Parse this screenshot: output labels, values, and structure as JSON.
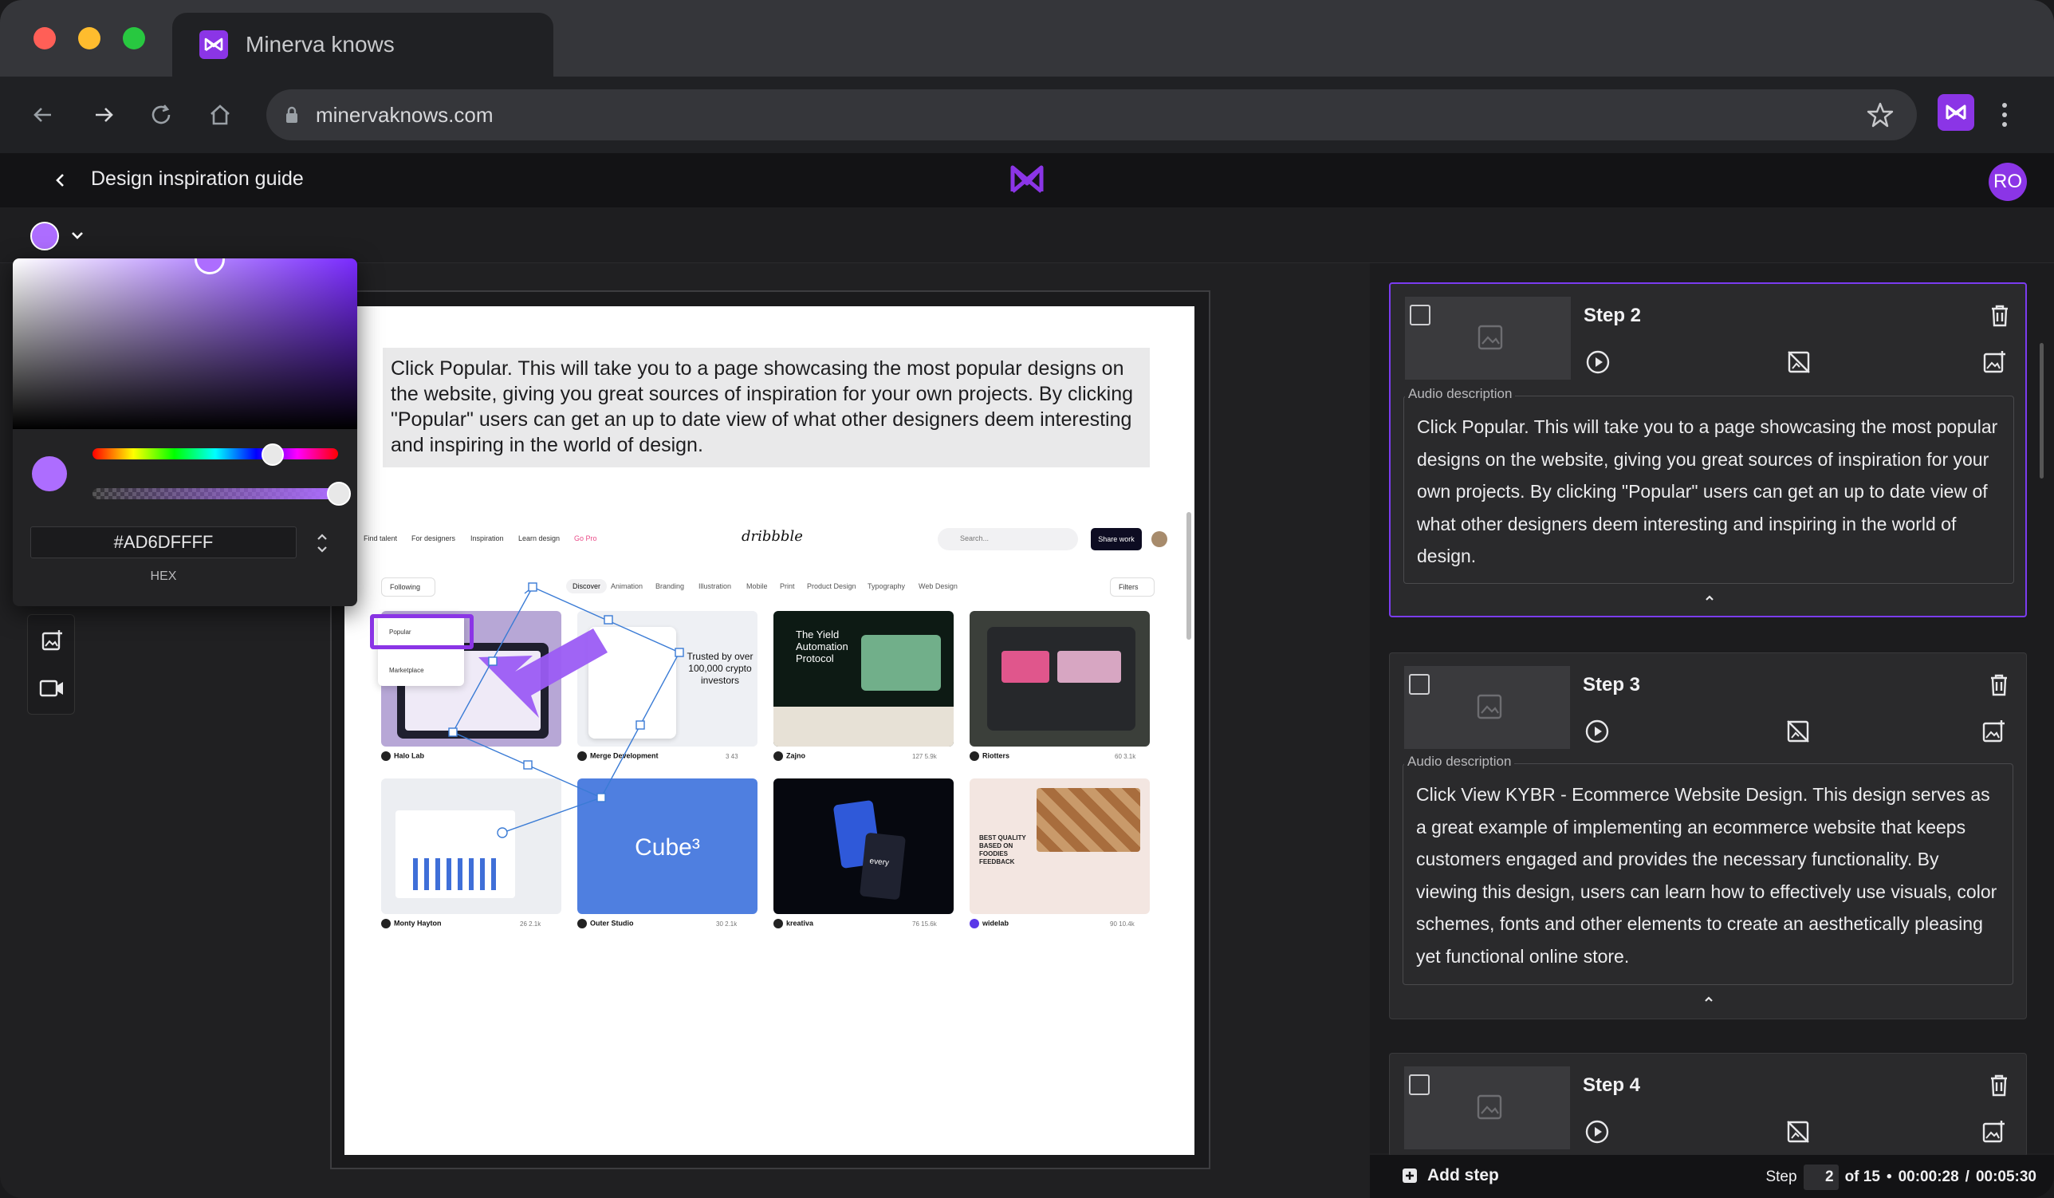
{
  "browser": {
    "tab_title": "Minerva knows",
    "url": "minervaknows.com"
  },
  "app": {
    "guide_title": "Design inspiration guide",
    "avatar_initials": "RO",
    "accent_color": "#8B35E6"
  },
  "color_picker": {
    "selected_color": "#AD6DFF",
    "hex_value": "#AD6DFFFF",
    "format_label": "HEX"
  },
  "canvas": {
    "caption": "Click Popular. This will take you to a page showcasing the most popular designs on the website, giving you great sources of inspiration for your own projects. By clicking \"Popular\" users can get an up to date view of what other designers deem interesting and inspiring in the world of design.",
    "screenshot": {
      "nav": [
        "Find talent",
        "For designers",
        "Inspiration",
        "Learn design",
        "Go Pro"
      ],
      "logo": "dribbble",
      "search_placeholder": "Search...",
      "share_button": "Share work",
      "following": "Following",
      "categories": [
        "Discover",
        "Animation",
        "Branding",
        "Illustration",
        "Mobile",
        "Print",
        "Product Design",
        "Typography",
        "Web Design"
      ],
      "filters": "Filters",
      "menu_items": [
        "Popular",
        "Marketplace"
      ],
      "shots": [
        {
          "author": "Halo Lab",
          "stats": "",
          "text": ""
        },
        {
          "author": "Merge Development",
          "stats": "3  43",
          "text": "Trusted by over 100,000 crypto investors"
        },
        {
          "author": "Zajno",
          "stats": "127  5.9k",
          "text": "The Yield Automation Protocol"
        },
        {
          "author": "Riotters",
          "stats": "60  3.1k",
          "text": ""
        },
        {
          "author": "Monty Hayton",
          "stats": "26  2.1k",
          "text": ""
        },
        {
          "author": "Outer Studio",
          "stats": "30  2.1k",
          "text": "Cube³"
        },
        {
          "author": "kreativa",
          "stats": "76  15.6k",
          "text": "every"
        },
        {
          "author": "widelab",
          "stats": "90  10.4k",
          "text": "BEST QUALITY BASED ON FOODIES FEEDBACK"
        }
      ]
    }
  },
  "steps": [
    {
      "title": "Step 2",
      "audio_label": "Audio description",
      "audio_text": "Click Popular. This will take you to a page showcasing the most popular designs on the website, giving you great sources of inspiration for your own projects. By clicking \"Popular\" users can get an up to date view of what other designers deem interesting and inspiring in the world of design."
    },
    {
      "title": "Step 3",
      "audio_label": "Audio description",
      "audio_text": "Click View KYBR - Ecommerce Website Design. This design serves as a great example of implementing an ecommerce website that keeps customers engaged and provides the necessary functionality. By viewing this design, users can learn how to effectively use visuals, color schemes, fonts and other elements to create an aesthetically pleasing yet functional online store."
    },
    {
      "title": "Step 4"
    }
  ],
  "footer": {
    "add_step": "Add step",
    "step_label": "Step",
    "current_step": "2",
    "of_total": "of 15",
    "time_current": "00:00:28",
    "time_total": "00:05:30"
  },
  "icons": {
    "back": "arrow-left-icon",
    "forward": "arrow-right-icon",
    "reload": "reload-icon",
    "home": "home-icon",
    "lock": "lock-icon",
    "bookmark": "star-icon",
    "play": "play-circle-icon",
    "hide_image": "hide-image-icon",
    "replace_image": "add-image-icon",
    "delete": "trash-icon",
    "video": "video-icon"
  }
}
